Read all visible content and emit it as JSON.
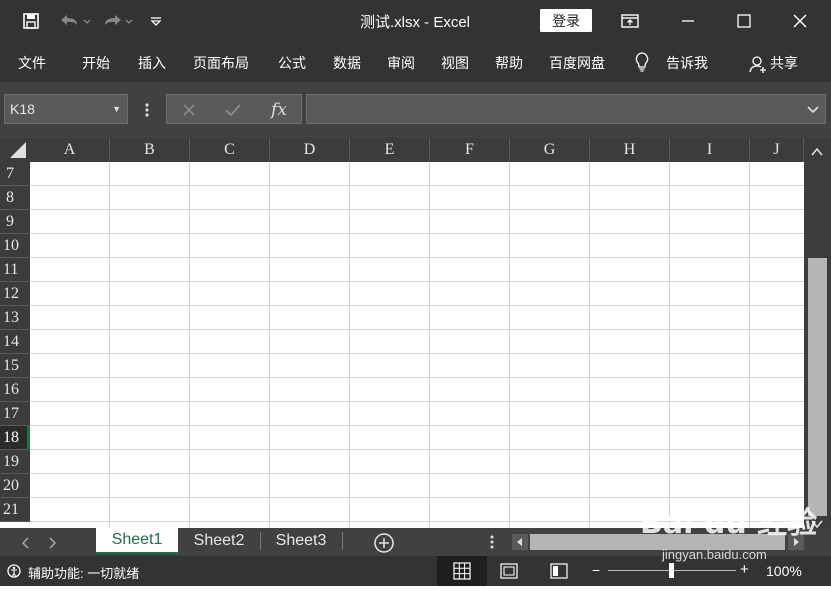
{
  "window": {
    "doc_title": "测试.xlsx  -  Excel",
    "login_label": "登录"
  },
  "ribbon": {
    "tabs": [
      "文件",
      "开始",
      "插入",
      "页面布局",
      "公式",
      "数据",
      "审阅",
      "视图",
      "帮助",
      "百度网盘"
    ],
    "tell_me": "告诉我",
    "share": "共享"
  },
  "formula_bar": {
    "name_box": "K18",
    "fx_label": "fx",
    "formula_value": ""
  },
  "grid": {
    "columns": [
      "A",
      "B",
      "C",
      "D",
      "E",
      "F",
      "G",
      "H",
      "I",
      "J"
    ],
    "rows": [
      "7",
      "8",
      "9",
      "10",
      "11",
      "12",
      "13",
      "14",
      "15",
      "16",
      "17",
      "18",
      "19",
      "20",
      "21"
    ],
    "active_row": "18"
  },
  "sheets": {
    "tabs": [
      "Sheet1",
      "Sheet2",
      "Sheet3"
    ],
    "active": "Sheet1"
  },
  "status": {
    "accessibility": "辅助功能: 一切就绪",
    "zoom": "100%"
  },
  "watermark": {
    "brand": "Bai du 经验",
    "url": "jingyan.baidu.com"
  },
  "icons": {
    "save": "save-icon",
    "undo": "undo-icon",
    "redo": "redo-icon",
    "customize": "customize-qat-icon",
    "ribbon_display": "ribbon-display-icon",
    "minimize": "minimize-icon",
    "maximize": "maximize-icon",
    "close": "close-icon",
    "lightbulb": "lightbulb-icon",
    "person": "person-icon"
  },
  "colors": {
    "title_bg": "#333333",
    "accent_green": "#1e7145",
    "header_bg": "#3c3c3c"
  }
}
